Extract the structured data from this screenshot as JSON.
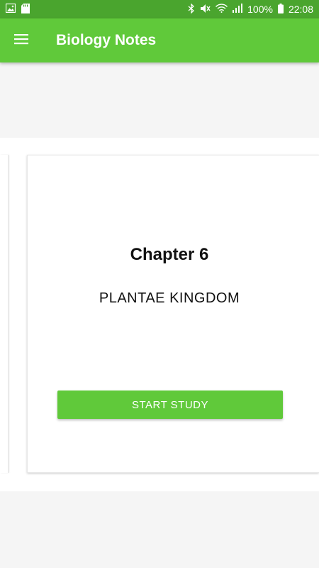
{
  "status_bar": {
    "left_icons": [
      "image-icon",
      "sd-card-icon"
    ],
    "right_icons": [
      "bluetooth-icon",
      "mute-icon",
      "wifi-icon",
      "signal-icon"
    ],
    "battery_text": "100%",
    "time": "22:08"
  },
  "app_bar": {
    "title": "Biology Notes",
    "menu_icon": "hamburger-menu-icon"
  },
  "card": {
    "chapter": "Chapter 6",
    "subtitle": "PLANTAE KINGDOM",
    "button_label": "START STUDY"
  },
  "colors": {
    "status_bar": "#4aa52e",
    "app_bar": "#60c93a",
    "button": "#60c93a",
    "background": "#f5f5f5",
    "card": "#ffffff"
  }
}
